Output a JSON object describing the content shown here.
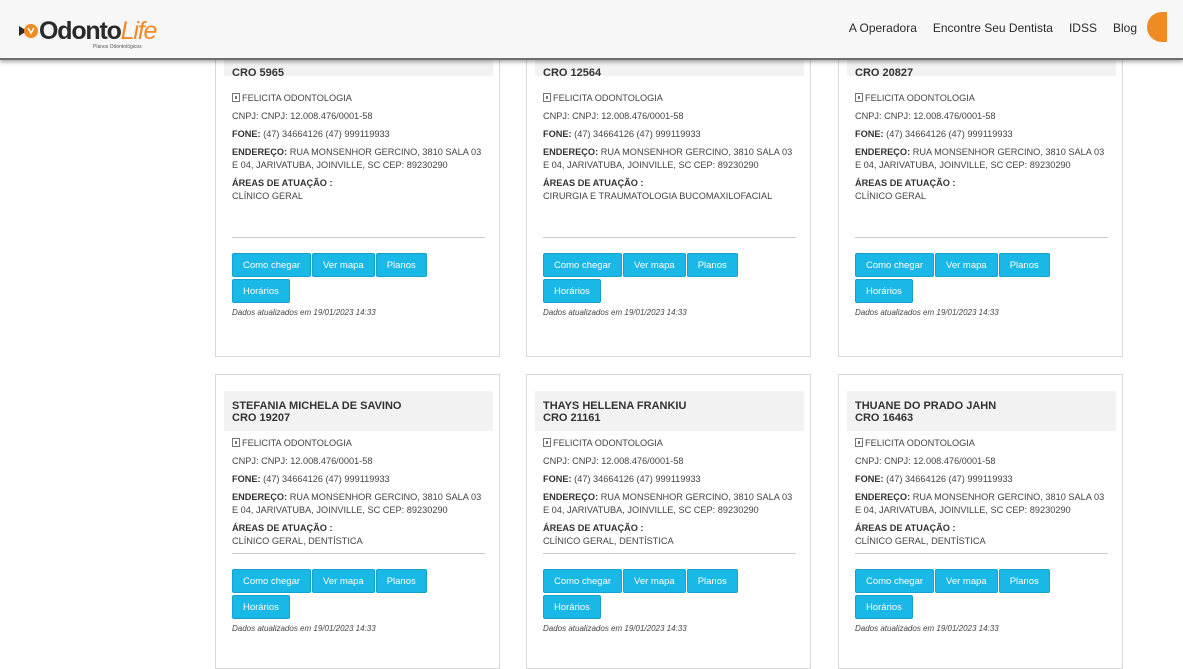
{
  "header": {
    "logo_text_main": "Odonto",
    "logo_text_accent": "Life",
    "logo_tagline": "Planos Odontológicos",
    "nav": [
      "A Operadora",
      "Encontre Seu Dentista",
      "IDSS",
      "Blog"
    ]
  },
  "labels": {
    "cnpj": "CNPJ: CNPJ: 12.008.476/0001-58",
    "fone_label": "FONE:",
    "fone_value": "(47) 34664126 (47) 999119933",
    "endereco_label": "ENDEREÇO:",
    "endereco_value": "RUA MONSENHOR GERCINO, 3810 SALA 03 E 04, JARIVATUBA, JOINVILLE, SC CEP: 89230290",
    "areas_label": "ÁREAS DE ATUAÇÃO :",
    "clinic": "FELICITA ODONTOLOGIA",
    "btn_como_chegar": "Como chegar",
    "btn_ver_mapa": "Ver mapa",
    "btn_planos": "Planos",
    "btn_horarios": "Horários",
    "updated": "Dados atualizados em 19/01/2023 14:33"
  },
  "cards": [
    {
      "name": "",
      "cro": "CRO 5965",
      "areas": "CLÍNICO GERAL"
    },
    {
      "name": "",
      "cro": "CRO 12564",
      "areas": "CIRURGIA E TRAUMATOLOGIA BUCOMAXILOFACIAL"
    },
    {
      "name": "",
      "cro": "CRO 20827",
      "areas": "CLÍNICO GERAL"
    },
    {
      "name": "STEFANIA MICHELA DE SAVINO",
      "cro": "CRO 19207",
      "areas": "CLÍNICO GERAL, DENTÍSTICA"
    },
    {
      "name": "THAYS HELLENA FRANKIU",
      "cro": "CRO 21161",
      "areas": "CLÍNICO GERAL, DENTÍSTICA"
    },
    {
      "name": "THUANE DO PRADO JAHN",
      "cro": "CRO 16463",
      "areas": "CLÍNICO GERAL, DENTÍSTICA"
    }
  ],
  "colors": {
    "accent": "#19b8e6",
    "brand_orange": "#f08a24"
  }
}
